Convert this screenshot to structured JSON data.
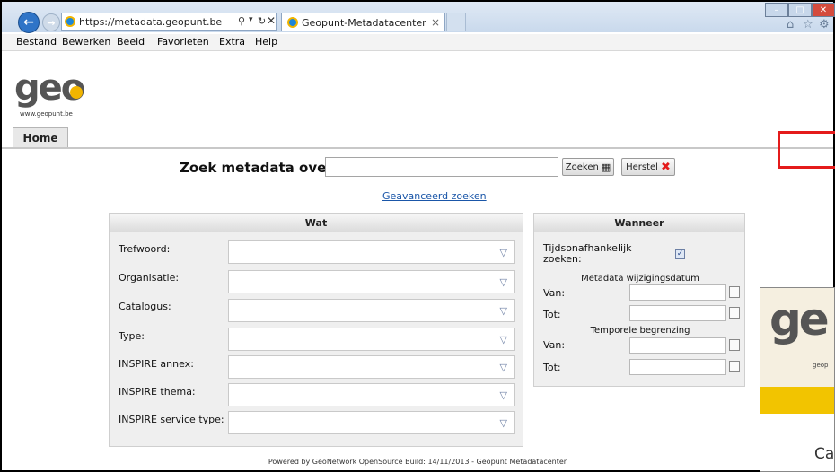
{
  "browser": {
    "address": "https://metadata.geopunt.be",
    "tab_title": "Geopunt-Metadatacenter",
    "tab_close": "×",
    "menu": [
      "Bestand",
      "Bewerken",
      "Beeld",
      "Favorieten",
      "Extra",
      "Help"
    ]
  },
  "site": {
    "logo": "geo",
    "logo_url": "www.geopunt.be",
    "home_tab": "Home"
  },
  "search": {
    "label": "Zoek metadata over",
    "value": "",
    "zoeken": "Zoeken",
    "herstel": "Herstel",
    "advanced": "Geavanceerd zoeken"
  },
  "wat": {
    "title": "Wat",
    "fields": [
      "Trefwoord:",
      "Organisatie:",
      "Catalogus:",
      "Type:",
      "INSPIRE annex:",
      "INSPIRE thema:",
      "INSPIRE service type:"
    ]
  },
  "wanneer": {
    "title": "Wanneer",
    "tijds_line1": "Tijdsonafhankelijk",
    "tijds_line2": "zoeken:",
    "tijds_checked": true,
    "metadata_date": "Metadata wijzigingsdatum",
    "van": "Van:",
    "tot": "Tot:",
    "temporal": "Temporele begrenzing"
  },
  "footer": "Powered by GeoNetwork OpenSource  Build: 14/11/2013 - Geopunt Metadatacenter",
  "overlay": {
    "logo": "ge",
    "sub": "geop",
    "text": "Ca"
  },
  "colors": {
    "accent": "#f0b400",
    "link": "#1a56a8",
    "highlight": "#e41b1b"
  }
}
